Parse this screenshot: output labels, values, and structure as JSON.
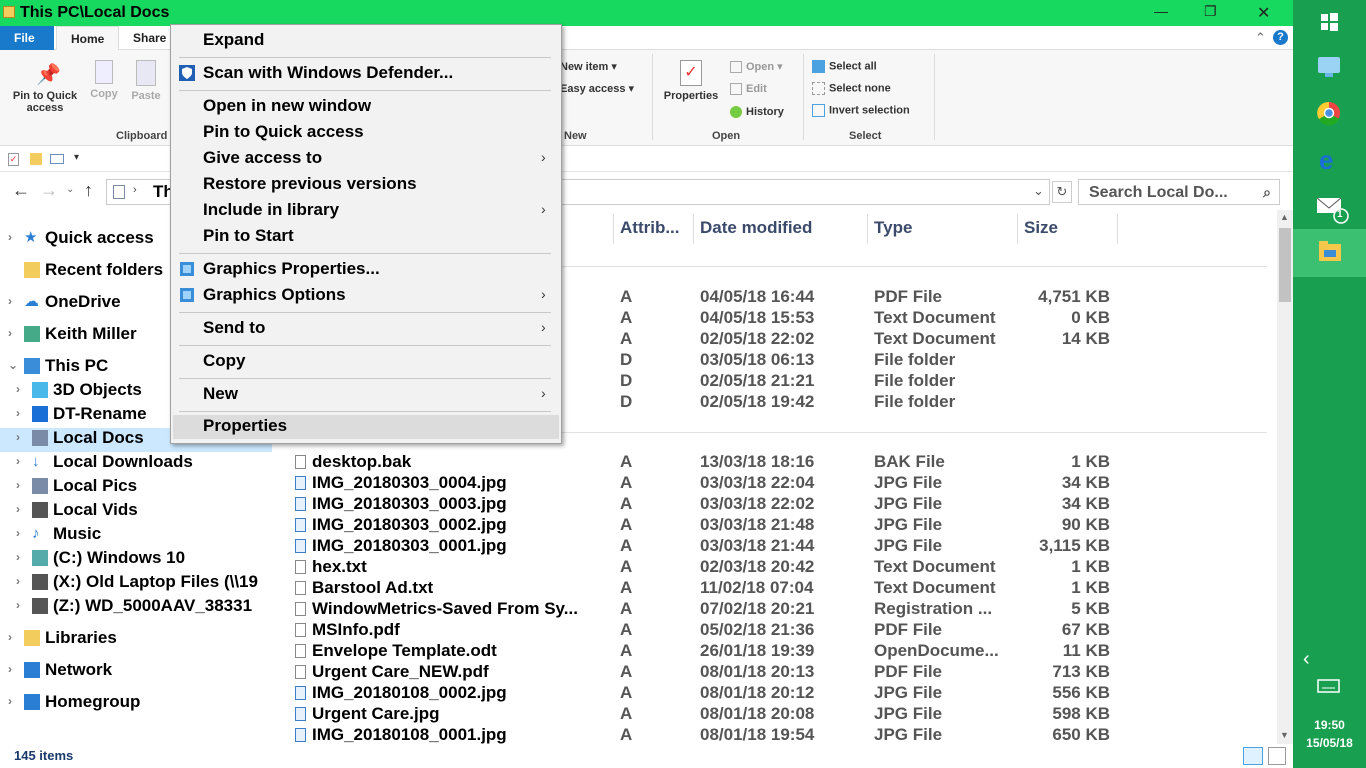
{
  "window": {
    "title": "This PC\\Local Docs",
    "min": "—",
    "max": "❐",
    "close": "✕"
  },
  "menubar": {
    "file": "File",
    "home": "Home",
    "share": "Share",
    "collapse": "⌃",
    "help": "?"
  },
  "ribbon": {
    "pin_quick_access": "Pin to Quick access",
    "copy": "Copy",
    "paste": "Paste",
    "clipboard_group": "Clipboard",
    "new_item": "New item ▾",
    "easy_access": "Easy access ▾",
    "new_group": "New",
    "properties": "Properties",
    "open": "Open ▾",
    "edit": "Edit",
    "history": "History",
    "open_group": "Open",
    "select_all": "Select all",
    "select_none": "Select none",
    "invert_selection": "Invert selection",
    "select_group": "Select"
  },
  "address": {
    "path_partial": "Th",
    "search_placeholder": "Search Local Do..."
  },
  "nav": [
    {
      "label": "Quick access",
      "chev": "›"
    },
    {
      "label": "Recent folders",
      "chev": ""
    },
    {
      "label": "OneDrive",
      "chev": "›"
    },
    {
      "label": "Keith Miller",
      "chev": "›"
    },
    {
      "label": "This PC",
      "chev": "⌄"
    },
    {
      "label": "3D Objects",
      "chev": "›"
    },
    {
      "label": "DT-Rename",
      "chev": "›"
    },
    {
      "label": "Local Docs",
      "chev": "›"
    },
    {
      "label": "Local Downloads",
      "chev": "›"
    },
    {
      "label": "Local Pics",
      "chev": "›"
    },
    {
      "label": "Local Vids",
      "chev": "›"
    },
    {
      "label": "Music",
      "chev": "›"
    },
    {
      "label": "(C:) Windows 10",
      "chev": "›"
    },
    {
      "label": "(X:) Old Laptop Files (\\\\19",
      "chev": "›"
    },
    {
      "label": "(Z:) WD_5000AAV_38331",
      "chev": "›"
    },
    {
      "label": "Libraries",
      "chev": "›"
    },
    {
      "label": "Network",
      "chev": "›"
    },
    {
      "label": "Homegroup",
      "chev": "›"
    }
  ],
  "columns": {
    "attrib": "Attrib...",
    "date": "Date modified",
    "type": "Type",
    "size": "Size"
  },
  "files_top": [
    {
      "name": "",
      "attr": "A",
      "date": "04/05/18 16:44",
      "type": "PDF File",
      "size": "4,751 KB"
    },
    {
      "name": "",
      "attr": "A",
      "date": "04/05/18 15:53",
      "type": "Text Document",
      "size": "0 KB"
    },
    {
      "name": "",
      "attr": "A",
      "date": "02/05/18 22:02",
      "type": "Text Document",
      "size": "14 KB"
    },
    {
      "name": "",
      "attr": "D",
      "date": "03/05/18 06:13",
      "type": "File folder",
      "size": ""
    },
    {
      "name": "",
      "attr": "D",
      "date": "02/05/18 21:21",
      "type": "File folder",
      "size": ""
    },
    {
      "name": "",
      "attr": "D",
      "date": "02/05/18 19:42",
      "type": "File folder",
      "size": ""
    }
  ],
  "files": [
    {
      "name": "desktop.bak",
      "attr": "A",
      "date": "13/03/18 18:16",
      "type": "BAK File",
      "size": "1 KB"
    },
    {
      "name": "IMG_20180303_0004.jpg",
      "attr": "A",
      "date": "03/03/18 22:04",
      "type": "JPG File",
      "size": "34 KB"
    },
    {
      "name": "IMG_20180303_0003.jpg",
      "attr": "A",
      "date": "03/03/18 22:02",
      "type": "JPG File",
      "size": "34 KB"
    },
    {
      "name": "IMG_20180303_0002.jpg",
      "attr": "A",
      "date": "03/03/18 21:48",
      "type": "JPG File",
      "size": "90 KB"
    },
    {
      "name": "IMG_20180303_0001.jpg",
      "attr": "A",
      "date": "03/03/18 21:44",
      "type": "JPG File",
      "size": "3,115 KB"
    },
    {
      "name": "hex.txt",
      "attr": "A",
      "date": "02/03/18 20:42",
      "type": "Text Document",
      "size": "1 KB"
    },
    {
      "name": "Barstool Ad.txt",
      "attr": "A",
      "date": "11/02/18 07:04",
      "type": "Text Document",
      "size": "1 KB"
    },
    {
      "name": "WindowMetrics-Saved From Sy...",
      "attr": "A",
      "date": "07/02/18 20:21",
      "type": "Registration ...",
      "size": "5 KB"
    },
    {
      "name": "MSInfo.pdf",
      "attr": "A",
      "date": "05/02/18 21:36",
      "type": "PDF File",
      "size": "67 KB"
    },
    {
      "name": "Envelope Template.odt",
      "attr": "A",
      "date": "26/01/18 19:39",
      "type": "OpenDocume...",
      "size": "11 KB"
    },
    {
      "name": "Urgent Care_NEW.pdf",
      "attr": "A",
      "date": "08/01/18 20:13",
      "type": "PDF File",
      "size": "713 KB"
    },
    {
      "name": "IMG_20180108_0002.jpg",
      "attr": "A",
      "date": "08/01/18 20:12",
      "type": "JPG File",
      "size": "556 KB"
    },
    {
      "name": "Urgent Care.jpg",
      "attr": "A",
      "date": "08/01/18 20:08",
      "type": "JPG File",
      "size": "598 KB"
    },
    {
      "name": "IMG_20180108_0001.jpg",
      "attr": "A",
      "date": "08/01/18 19:54",
      "type": "JPG File",
      "size": "650 KB"
    }
  ],
  "status": {
    "count": "145 items"
  },
  "context_menu": {
    "expand": "Expand",
    "scan": "Scan with Windows Defender...",
    "open_new_window": "Open in new window",
    "pin_quick": "Pin to Quick access",
    "give_access": "Give access to",
    "restore": "Restore previous versions",
    "include_library": "Include in library",
    "pin_start": "Pin to Start",
    "graphics_properties": "Graphics Properties...",
    "graphics_options": "Graphics Options",
    "send_to": "Send to",
    "copy": "Copy",
    "new": "New",
    "properties": "Properties",
    "arrow": "›"
  },
  "taskbar": {
    "time": "19:50",
    "date": "15/05/18",
    "mail_badge": "1",
    "back": "‹"
  },
  "colors": {
    "titlebar": "#18d960",
    "taskbar": "#18a050",
    "file_tab": "#1979ca",
    "selection": "#cce8ff"
  }
}
